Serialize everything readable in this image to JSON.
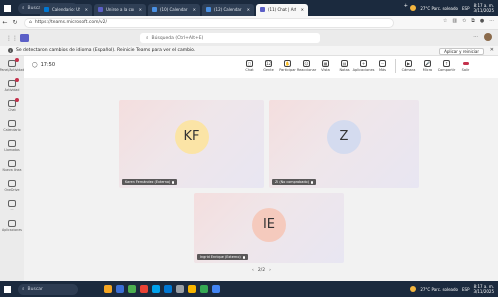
{
  "taskbar": {
    "search_label": "Buscar",
    "weather": "27°C Parc. soleado",
    "lang": "ESP",
    "time": "8:17 a. m.",
    "date": "3/11/2025",
    "app_colors": [
      "#f5a623",
      "#3b6fd6",
      "#4caf50",
      "#e94235",
      "#00a2ed",
      "#0078d4",
      "#9aa0a6",
      "#f7b500",
      "#34a853",
      "#4285f4"
    ]
  },
  "browser": {
    "tabs": [
      {
        "label": "Calendario: USETT RODRIGU",
        "color": "#0078d4"
      },
      {
        "label": "Unirse a la conversación",
        "color": "#5b5fc7"
      },
      {
        "label": "(10) Calendar | Calendar | Mi",
        "color": "#4a90e2"
      },
      {
        "label": "(12) Calendar | Calendar | Mi",
        "color": "#4a90e2"
      },
      {
        "label": "(11) Chat | Articulación | X",
        "color": "#5b5fc7"
      }
    ],
    "new_tab": "+",
    "url": "https://teams.microsoft.com/v2/"
  },
  "teams": {
    "search_placeholder": "Búsqueda (Ctrl+Alt+E)",
    "more": "···"
  },
  "notification": {
    "text": "Se detectaron cambios de idioma (Español). Reinicie Teams para ver el cambio.",
    "button": "Aplicar y reiniciar",
    "close": "✕"
  },
  "rail": {
    "items": [
      {
        "label": "Panel/Actividad",
        "badge": true
      },
      {
        "label": "Actividad",
        "badge": true
      },
      {
        "label": "Chat",
        "badge": true
      },
      {
        "label": "Calendario",
        "badge": false
      },
      {
        "label": "Llamadas",
        "badge": false
      },
      {
        "label": "Nueva línea",
        "badge": false
      },
      {
        "label": "OneDrive",
        "badge": false
      },
      {
        "label": "···",
        "badge": false
      },
      {
        "label": "Aplicaciones",
        "badge": false
      }
    ]
  },
  "meeting": {
    "timer": "17:50",
    "controls": [
      {
        "label": "Chat",
        "icon": "chat-icon",
        "glyph": "◻"
      },
      {
        "label": "Gente",
        "icon": "people-icon",
        "glyph": "12"
      },
      {
        "label": "Participar",
        "icon": "raise-hand-icon",
        "glyph": "✋"
      },
      {
        "label": "Reaccionar",
        "icon": "react-icon",
        "glyph": "☺"
      },
      {
        "label": "Vista",
        "icon": "view-icon",
        "glyph": "▦"
      },
      {
        "label": "Notas",
        "icon": "notes-icon",
        "glyph": "▤"
      },
      {
        "label": "Aplicaciones",
        "icon": "apps-icon",
        "glyph": "+"
      },
      {
        "label": "Más",
        "icon": "more-icon",
        "glyph": "···"
      }
    ],
    "media_controls": [
      {
        "label": "Cámara",
        "icon": "camera-icon",
        "glyph": "▶"
      },
      {
        "label": "Micro",
        "icon": "mic-icon",
        "glyph": "🎤"
      },
      {
        "label": "Compartir",
        "icon": "share-icon",
        "glyph": "↑"
      },
      {
        "label": "Salir",
        "icon": "leave-icon",
        "glyph": ""
      }
    ],
    "participants": [
      {
        "initials": "KF",
        "name": "Karen Fernández (Externo)",
        "tile_bg": "#fff",
        "ring": "#f5e3a8",
        "text": "#333"
      },
      {
        "initials": "Z",
        "name": "Zi (No comprobado)",
        "tile_bg": "#fff",
        "ring": "#c7cfe3",
        "text": "#333"
      },
      {
        "initials": "IE",
        "name": "Ingrid Enrique (Externo)",
        "tile_bg": "#fff",
        "ring": "#f3c6b9",
        "text": "#333"
      }
    ],
    "pager": "2/2"
  },
  "colors": {
    "teams_purple": "#5b5fc7",
    "hangup_red": "#c4314b"
  }
}
